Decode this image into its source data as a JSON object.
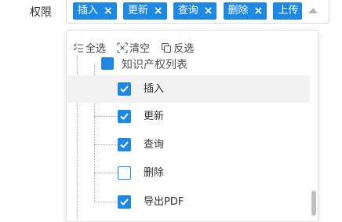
{
  "field": {
    "label": "权限"
  },
  "select": {
    "tags": [
      {
        "label": "插入"
      },
      {
        "label": "更新"
      },
      {
        "label": "查询"
      },
      {
        "label": "删除"
      },
      {
        "label": "上传"
      }
    ],
    "tag_close": "×"
  },
  "toolbar": {
    "select_all": "全选",
    "clear": "清空",
    "invert": "反选"
  },
  "tree": {
    "parent": {
      "label": "知识产权列表",
      "checked": true
    },
    "items": [
      {
        "label": "插入",
        "checked": true,
        "hover": true
      },
      {
        "label": "更新",
        "checked": true
      },
      {
        "label": "查询",
        "checked": true
      },
      {
        "label": "删除",
        "checked": false
      },
      {
        "label": "导出PDF",
        "checked": true
      }
    ]
  },
  "colors": {
    "accent": "#1e88e5",
    "hover_bg": "#f2f2f2"
  }
}
